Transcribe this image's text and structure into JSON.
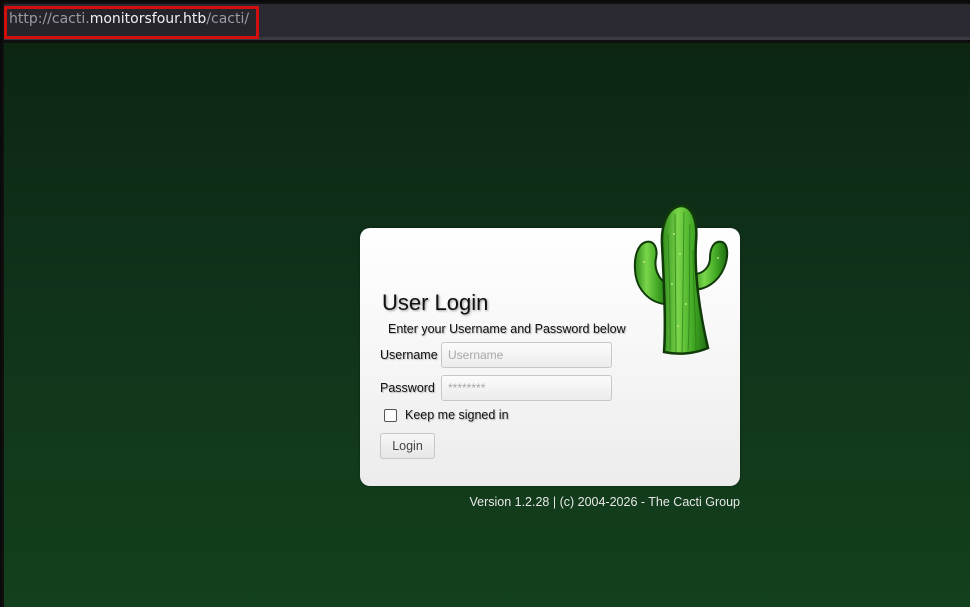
{
  "browser": {
    "url_scheme": "http://",
    "url_subdomain": "cacti.",
    "url_host": "monitorsfour.htb",
    "url_path": "/cacti/"
  },
  "login": {
    "title": "User Login",
    "subtitle": "Enter your Username and Password below",
    "username_label": "Username",
    "username_placeholder": "Username",
    "password_label": "Password",
    "password_placeholder": "********",
    "remember_label": "Keep me signed in",
    "remember_checked": false,
    "submit_label": "Login"
  },
  "footer": {
    "version_text": "Version 1.2.28 | (c) 2004-2026 - The Cacti Group"
  },
  "icons": {
    "logo": "cactus-logo-icon"
  },
  "colors": {
    "background": "#10331a",
    "url_highlight": "#d10f0f",
    "cactus_green": "#4caf2a"
  }
}
